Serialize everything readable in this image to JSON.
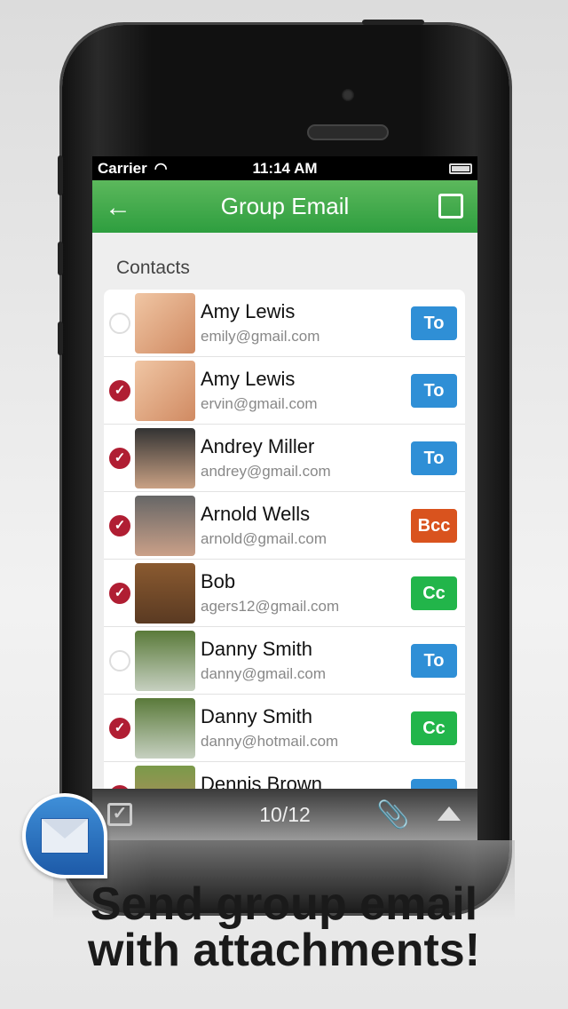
{
  "status": {
    "carrier": "Carrier",
    "time": "11:14 AM"
  },
  "nav": {
    "title": "Group Email",
    "back_icon": "arrow-left-icon",
    "compose_icon": "compose-icon",
    "color": "#3ca84a"
  },
  "section_title": "Contacts",
  "contacts": [
    {
      "name": "Amy Lewis",
      "email": "emily@gmail.com",
      "selected": false,
      "type": "To"
    },
    {
      "name": "Amy Lewis",
      "email": "ervin@gmail.com",
      "selected": true,
      "type": "To"
    },
    {
      "name": "Andrey Miller",
      "email": "andrey@gmail.com",
      "selected": true,
      "type": "To"
    },
    {
      "name": "Arnold Wells",
      "email": "arnold@gmail.com",
      "selected": true,
      "type": "Bcc"
    },
    {
      "name": "Bob",
      "email": "agers12@gmail.com",
      "selected": true,
      "type": "Cc"
    },
    {
      "name": "Danny Smith",
      "email": "danny@gmail.com",
      "selected": false,
      "type": "To"
    },
    {
      "name": "Danny Smith",
      "email": "danny@hotmail.com",
      "selected": true,
      "type": "Cc"
    },
    {
      "name": "Dennis Brown",
      "email": "",
      "selected": true,
      "type": ""
    }
  ],
  "badge_colors": {
    "To": "#2f8fd6",
    "Cc": "#22b54a",
    "Bcc": "#d9531e"
  },
  "toolbar": {
    "count": "10/12"
  },
  "headline": {
    "line1": "Send group email",
    "line2": "with attachments!"
  }
}
